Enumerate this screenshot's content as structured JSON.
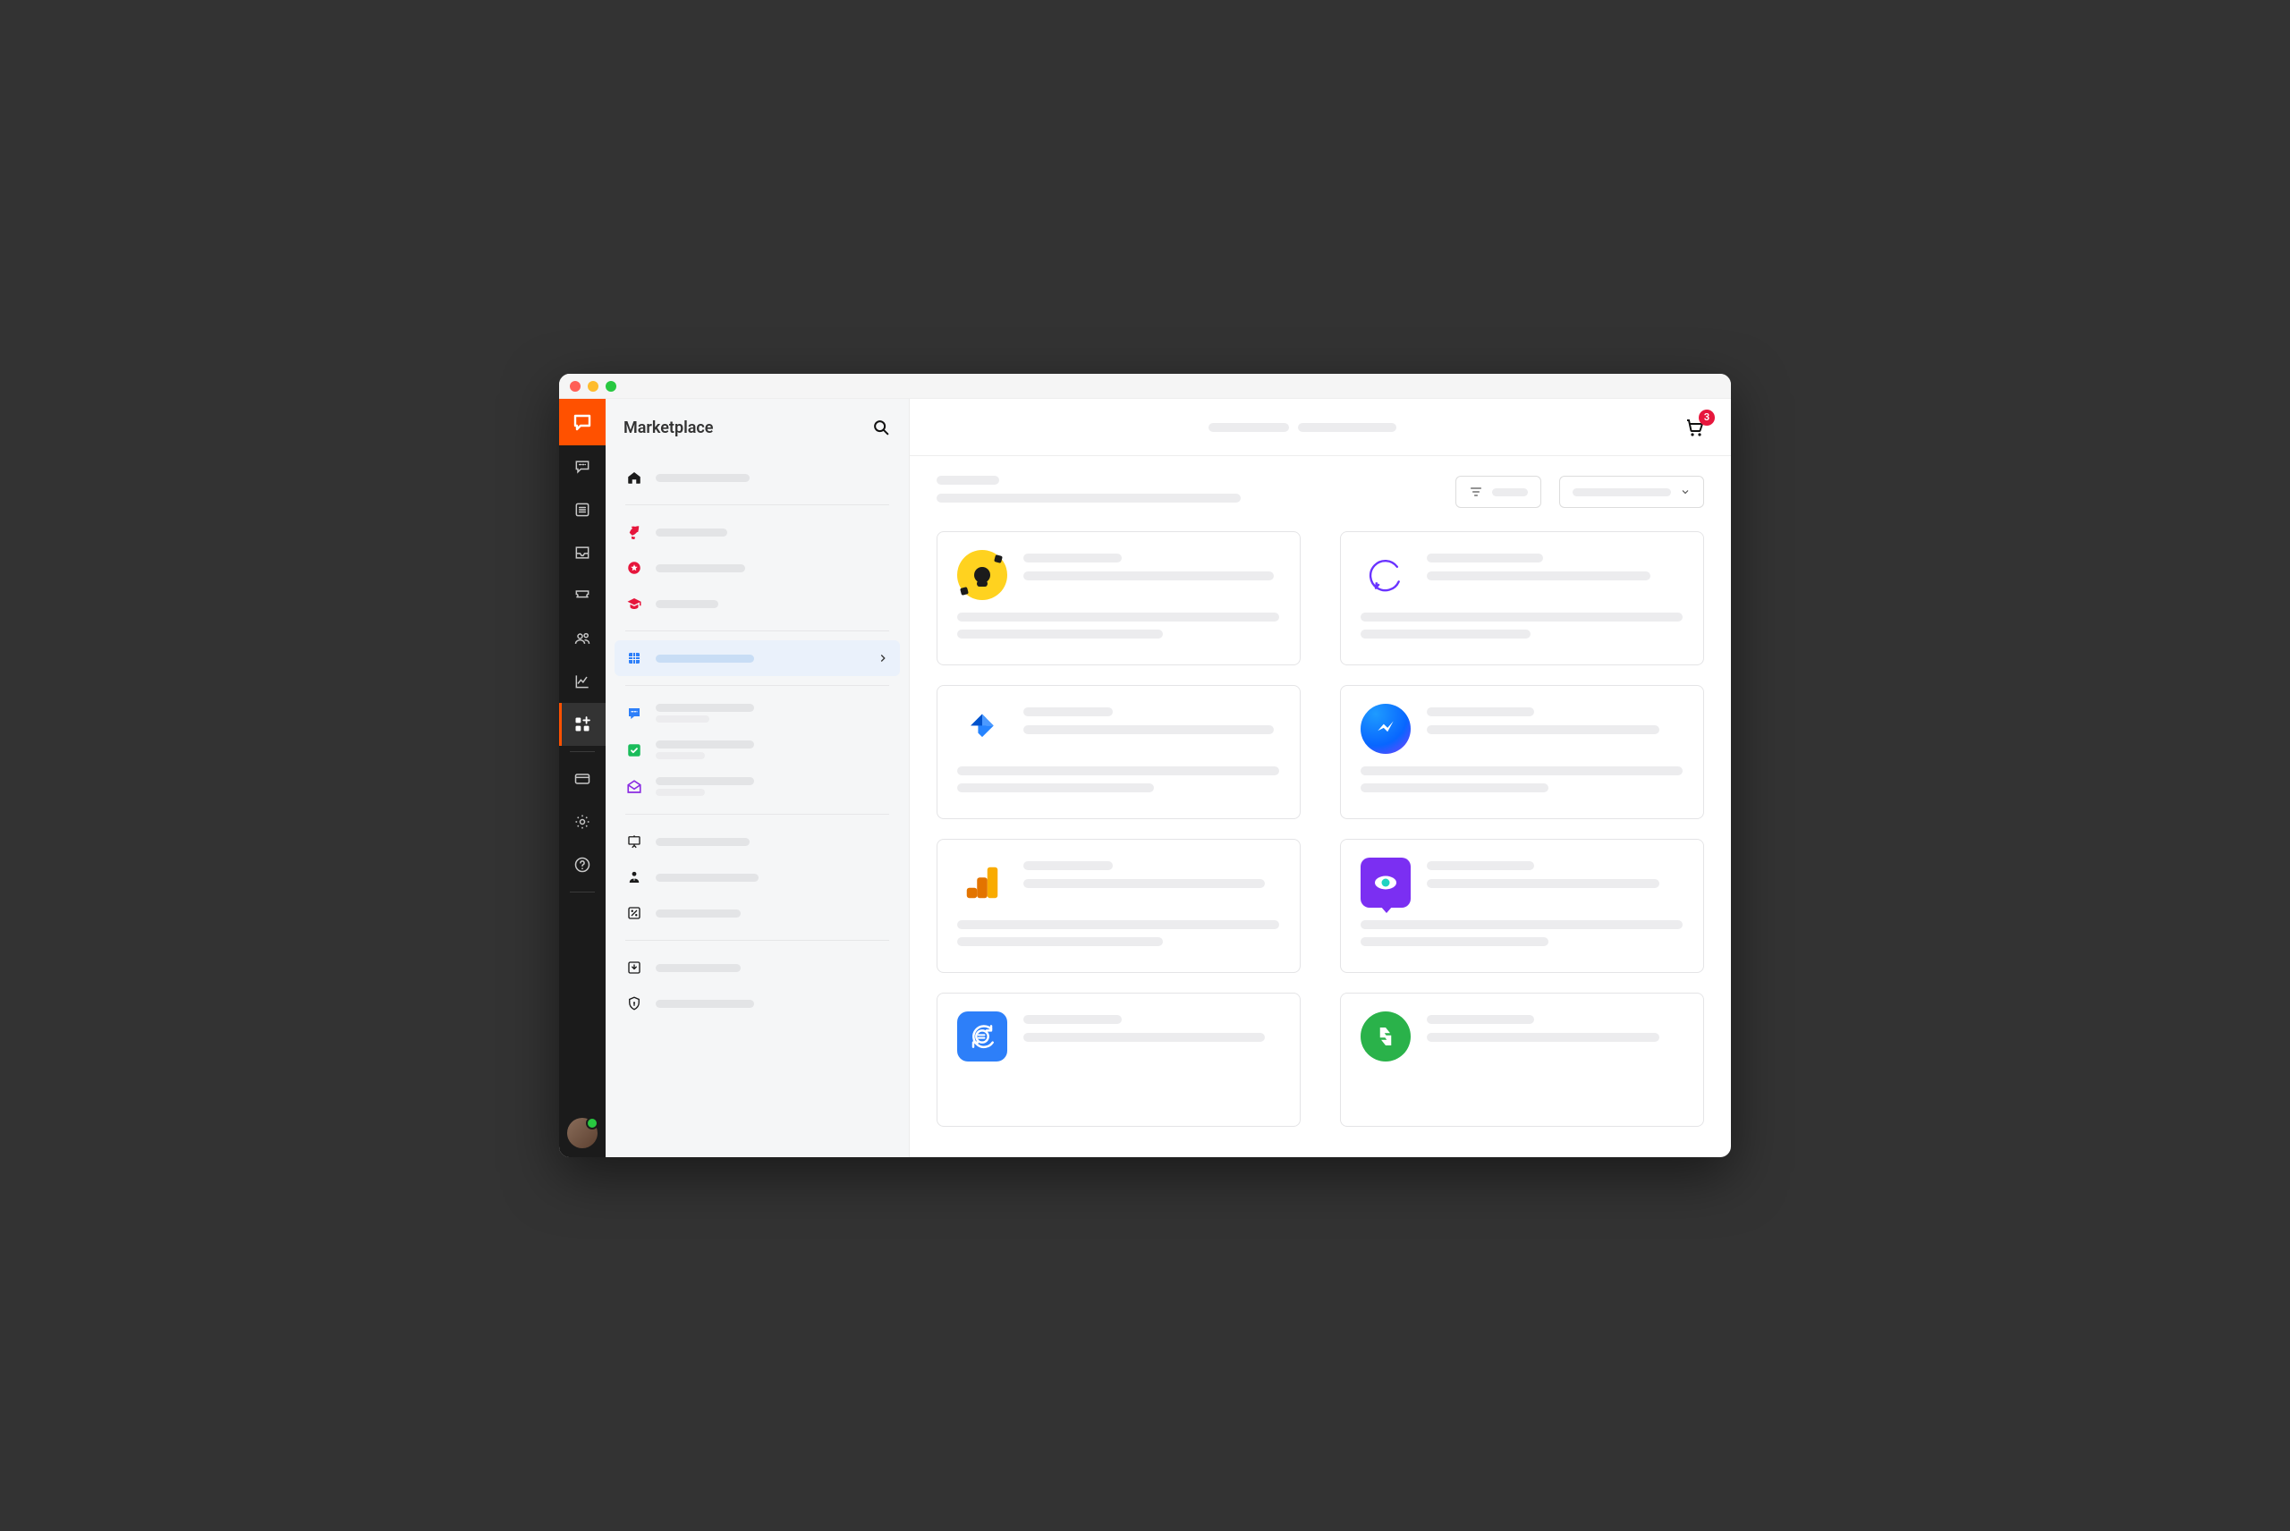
{
  "window": {
    "title": "Marketplace"
  },
  "rail": {
    "logo_icon": "chat-bubble-logo",
    "items": [
      {
        "icon": "chat-bubble-icon"
      },
      {
        "icon": "list-icon"
      },
      {
        "icon": "inbox-icon"
      },
      {
        "icon": "ticket-icon"
      },
      {
        "icon": "users-icon"
      },
      {
        "icon": "chart-line-icon"
      }
    ],
    "active_icon": "apps-add-icon",
    "lower_items": [
      {
        "icon": "card-icon"
      },
      {
        "icon": "gear-icon"
      },
      {
        "icon": "help-circle-icon"
      }
    ]
  },
  "sidebar": {
    "title": "Marketplace",
    "groups": [
      {
        "icon": "home-icon",
        "color": "#1b1b1b",
        "w": 105
      },
      null,
      {
        "icon": "rocket-icon",
        "color": "#e6163c",
        "w": 80
      },
      {
        "icon": "star-circle-icon",
        "color": "#e6163c",
        "w": 100
      },
      {
        "icon": "graduation-cap-icon",
        "color": "#e6163c",
        "w": 70
      },
      null,
      {
        "icon": "grid-icon",
        "color": "#2d7ff9",
        "w": 110,
        "selected": true,
        "chevron": true
      },
      null,
      {
        "icon": "chat-square-icon",
        "color": "#2d7ff9",
        "w": 110,
        "sub": 60
      },
      {
        "icon": "check-square-icon",
        "color": "#1abc5b",
        "w": 110,
        "sub": 55
      },
      {
        "icon": "mail-open-icon",
        "color": "#8a2be2",
        "w": 110,
        "sub": 55
      },
      null,
      {
        "icon": "presentation-icon",
        "color": "#1b1b1b",
        "w": 105
      },
      {
        "icon": "person-suit-icon",
        "color": "#1b1b1b",
        "w": 115
      },
      {
        "icon": "percent-square-icon",
        "color": "#1b1b1b",
        "w": 95
      },
      null,
      {
        "icon": "download-box-icon",
        "color": "#1b1b1b",
        "w": 95
      },
      {
        "icon": "shield-icon",
        "color": "#1b1b1b",
        "w": 110
      }
    ]
  },
  "topbar": {
    "center_ghosts": [
      90,
      110
    ],
    "cart_count": "3"
  },
  "content_head": {
    "title_w": 70,
    "subtitle_w": 340,
    "filter_w": 40,
    "sort_w": 110
  },
  "cards": [
    {
      "id": "knowledgebase",
      "icon": "knowledge-icon",
      "top_lines": [
        110,
        280
      ],
      "bottom_lines": [
        360,
        230
      ]
    },
    {
      "id": "crisp",
      "icon": "circle-c-icon",
      "top_lines": [
        130,
        250
      ],
      "bottom_lines": [
        360,
        190
      ]
    },
    {
      "id": "jira",
      "icon": "jira-icon",
      "top_lines": [
        100,
        280
      ],
      "bottom_lines": [
        360,
        220
      ]
    },
    {
      "id": "messenger",
      "icon": "messenger-icon",
      "top_lines": [
        120,
        260
      ],
      "bottom_lines": [
        360,
        210
      ]
    },
    {
      "id": "analytics",
      "icon": "analytics-icon",
      "top_lines": [
        100,
        270
      ],
      "bottom_lines": [
        360,
        230
      ]
    },
    {
      "id": "hotjar",
      "icon": "eye-icon",
      "top_lines": [
        120,
        260
      ],
      "bottom_lines": [
        360,
        210
      ]
    },
    {
      "id": "currency",
      "icon": "euro-cycle-icon",
      "top_lines": [
        110,
        270
      ],
      "bottom_lines": []
    },
    {
      "id": "recycle",
      "icon": "recycle-icon",
      "top_lines": [
        120,
        260
      ],
      "bottom_lines": []
    }
  ]
}
